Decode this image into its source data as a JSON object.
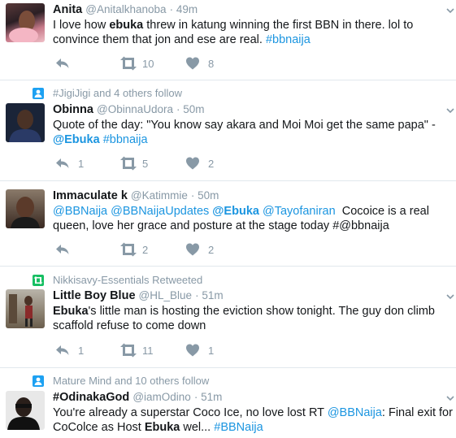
{
  "tweets": [
    {
      "name": "Anita",
      "handle": "@Anitalkhanoba",
      "time": "· 49m",
      "text_segments": [
        {
          "t": "I love how ",
          "s": "plain"
        },
        {
          "t": "ebuka",
          "s": "bold"
        },
        {
          "t": " threw in katung winning the first BBN in there. lol to convince them that jon and ese are real. ",
          "s": "plain"
        },
        {
          "t": "#bbnaija",
          "s": "link"
        }
      ],
      "replies": "",
      "retweets": "10",
      "likes": "8"
    },
    {
      "context": "#JigiJigi and 4 others follow",
      "context_icon": "follow",
      "name": "Obinna",
      "handle": "@ObinnaUdora",
      "time": "· 50m",
      "text_segments": [
        {
          "t": "Quote of the day: \"You know say akara and Moi Moi get the same papa\" - ",
          "s": "plain"
        },
        {
          "t": "@Ebuka",
          "s": "linkbold"
        },
        {
          "t": " ",
          "s": "plain"
        },
        {
          "t": "#bbnaija",
          "s": "link"
        }
      ],
      "replies": "1",
      "retweets": "5",
      "likes": "2"
    },
    {
      "name": "Immaculate k",
      "handle": "@Katimmie",
      "time": "· 50m",
      "text_segments": [
        {
          "t": "@BBNaija",
          "s": "link"
        },
        {
          "t": " ",
          "s": "plain"
        },
        {
          "t": "@BBNaijaUpdates",
          "s": "link"
        },
        {
          "t": " ",
          "s": "plain"
        },
        {
          "t": "@Ebuka",
          "s": "linkbold"
        },
        {
          "t": " ",
          "s": "plain"
        },
        {
          "t": "@Tayofaniran",
          "s": "link"
        },
        {
          "t": "  Cocoice is a real queen, love her grace and posture at the stage today #@bbnaija",
          "s": "plain"
        }
      ],
      "replies": "",
      "retweets": "2",
      "likes": "2"
    },
    {
      "context": "Nikkisavy-Essentials Retweeted",
      "context_icon": "retweet",
      "name": "Little Boy Blue",
      "handle": "@HL_Blue",
      "time": "· 51m",
      "text_segments": [
        {
          "t": "Ebuka",
          "s": "bold"
        },
        {
          "t": "'s little man is hosting the eviction show tonight. The guy don climb scaffold refuse to come down",
          "s": "plain"
        }
      ],
      "replies": "1",
      "retweets": "11",
      "likes": "1"
    },
    {
      "context": "Mature Mind and 10 others follow",
      "context_icon": "follow",
      "name": "#OdinakaGod",
      "handle": "@iamOdino",
      "time": "· 51m",
      "text_segments": [
        {
          "t": "You're already a superstar Coco Ice, no love lost RT ",
          "s": "plain"
        },
        {
          "t": "@BBNaija",
          "s": "link"
        },
        {
          "t": ": Final exit for CoColce as Host ",
          "s": "plain"
        },
        {
          "t": "Ebuka",
          "s": "bold"
        },
        {
          "t": " wel... ",
          "s": "plain"
        },
        {
          "t": "#BBNaija",
          "s": "link"
        }
      ]
    }
  ],
  "colors": {
    "link": "#1b95e0",
    "muted": "#8899a6",
    "follow_icon": "#1da1f2",
    "retweet_icon": "#17bf63"
  },
  "icons": [
    "reply-icon",
    "retweet-icon",
    "like-icon",
    "caret-down-icon",
    "follow-context-icon",
    "retweet-context-icon"
  ]
}
